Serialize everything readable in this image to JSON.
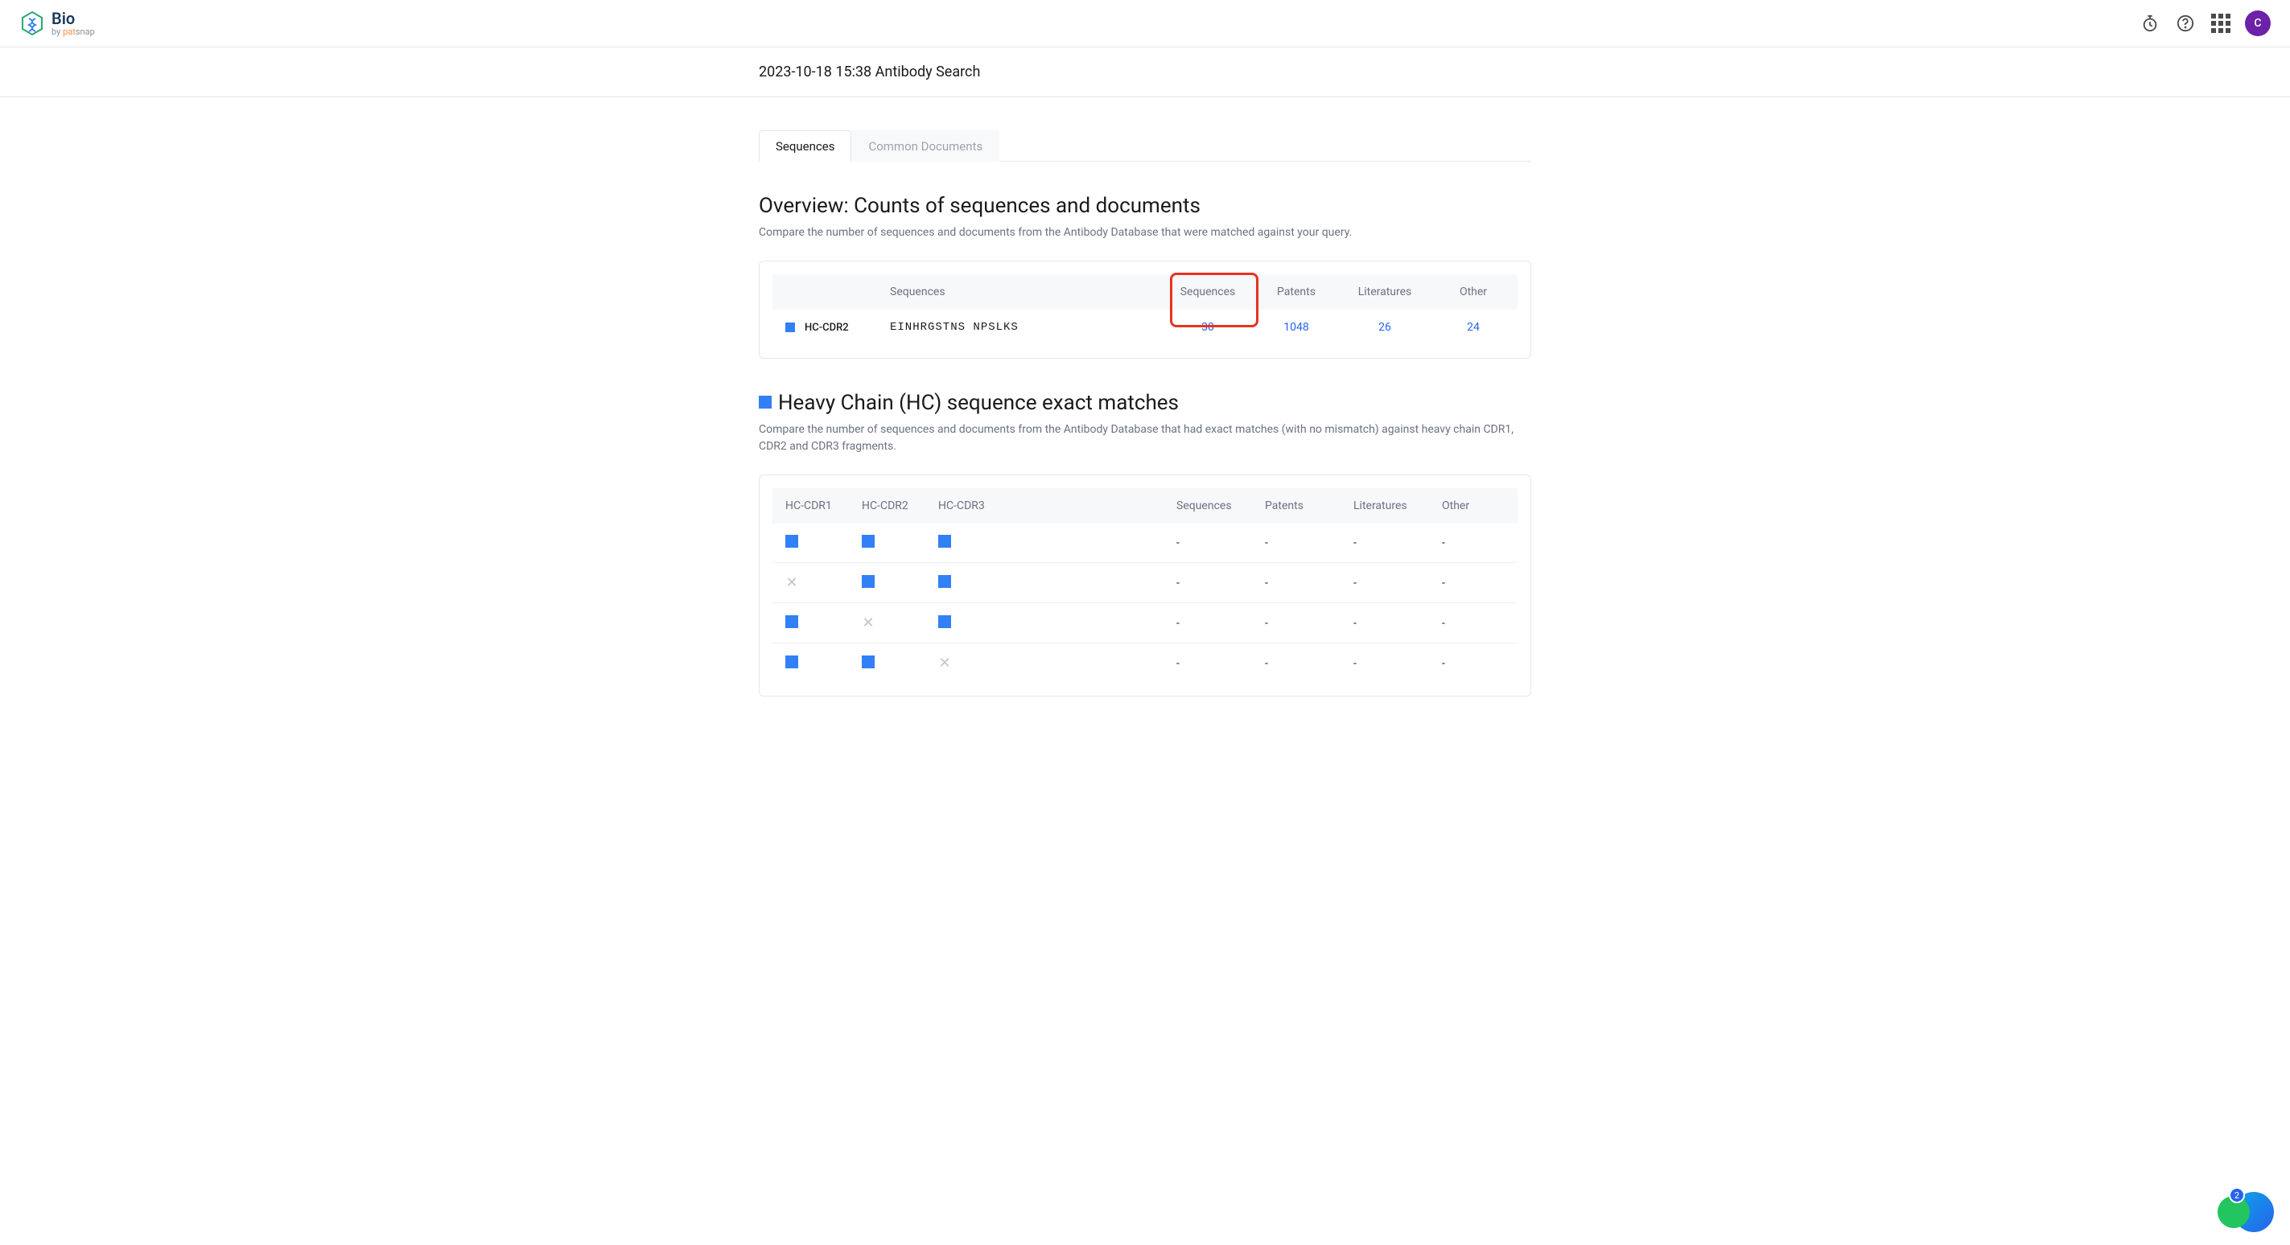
{
  "header": {
    "logo_title": "Bio",
    "logo_by": "by ",
    "logo_brand_prefix": "pat",
    "logo_brand_suffix": "snap",
    "avatar_initial": "C"
  },
  "page": {
    "title": "2023-10-18 15:38 Antibody Search"
  },
  "tabs": {
    "sequences": "Sequences",
    "common_documents": "Common Documents"
  },
  "overview": {
    "title": "Overview: Counts of sequences and documents",
    "desc": "Compare the number of sequences and documents from the Antibody Database that were matched against your query.",
    "headers": {
      "col1": "",
      "col2": "Sequences",
      "sequences": "Sequences",
      "patents": "Patents",
      "literatures": "Literatures",
      "other": "Other"
    },
    "row": {
      "label": "HC-CDR2",
      "seq_text": "EINHRGSTNS NPSLKS",
      "sequences": "30",
      "patents": "1048",
      "literatures": "26",
      "other": "24"
    }
  },
  "heavy": {
    "title": "Heavy Chain (HC) sequence exact matches",
    "desc": "Compare the number of sequences and documents from the Antibody Database that had exact matches (with no mismatch) against heavy chain CDR1, CDR2 and CDR3 fragments.",
    "headers": {
      "cdr1": "HC-CDR1",
      "cdr2": "HC-CDR2",
      "cdr3": "HC-CDR3",
      "sequences": "Sequences",
      "patents": "Patents",
      "literatures": "Literatures",
      "other": "Other"
    },
    "rows": [
      {
        "cdr1": "filled",
        "cdr2": "filled",
        "cdr3": "filled",
        "sequences": "-",
        "patents": "-",
        "literatures": "-",
        "other": "-"
      },
      {
        "cdr1": "x",
        "cdr2": "filled",
        "cdr3": "filled",
        "sequences": "-",
        "patents": "-",
        "literatures": "-",
        "other": "-"
      },
      {
        "cdr1": "filled",
        "cdr2": "x",
        "cdr3": "filled",
        "sequences": "-",
        "patents": "-",
        "literatures": "-",
        "other": "-"
      },
      {
        "cdr1": "filled",
        "cdr2": "filled",
        "cdr3": "x",
        "sequences": "-",
        "patents": "-",
        "literatures": "-",
        "other": "-"
      }
    ]
  },
  "fab": {
    "badge": "2"
  }
}
